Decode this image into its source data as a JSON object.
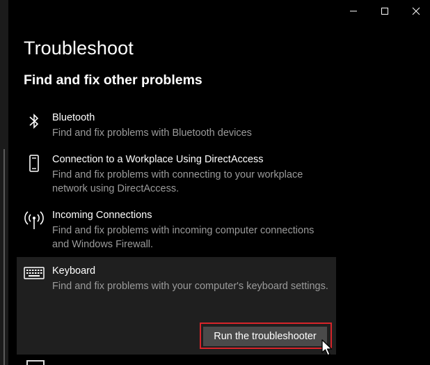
{
  "window": {
    "controls": {
      "minimize": "minimize-icon",
      "maximize": "maximize-icon",
      "close": "close-icon"
    }
  },
  "page": {
    "title": "Troubleshoot",
    "section_title": "Find and fix other problems"
  },
  "items": [
    {
      "icon": "bluetooth-icon",
      "name": "Bluetooth",
      "description": "Find and fix problems with Bluetooth devices"
    },
    {
      "icon": "phone-device-icon",
      "name": "Connection to a Workplace Using DirectAccess",
      "description": "Find and fix problems with connecting to your workplace network using DirectAccess."
    },
    {
      "icon": "antenna-signal-icon",
      "name": "Incoming Connections",
      "description": "Find and fix problems with incoming computer connections and Windows Firewall."
    },
    {
      "icon": "keyboard-icon",
      "name": "Keyboard",
      "description": "Find and fix problems with your computer's keyboard settings.",
      "selected": true,
      "action_label": "Run the troubleshooter"
    }
  ],
  "colors": {
    "background": "#000000",
    "selected_item_bg": "#1f1f1f",
    "button_bg": "#4a4a4a",
    "highlight_border": "#d8242a",
    "secondary_text": "#9b9b9b"
  }
}
